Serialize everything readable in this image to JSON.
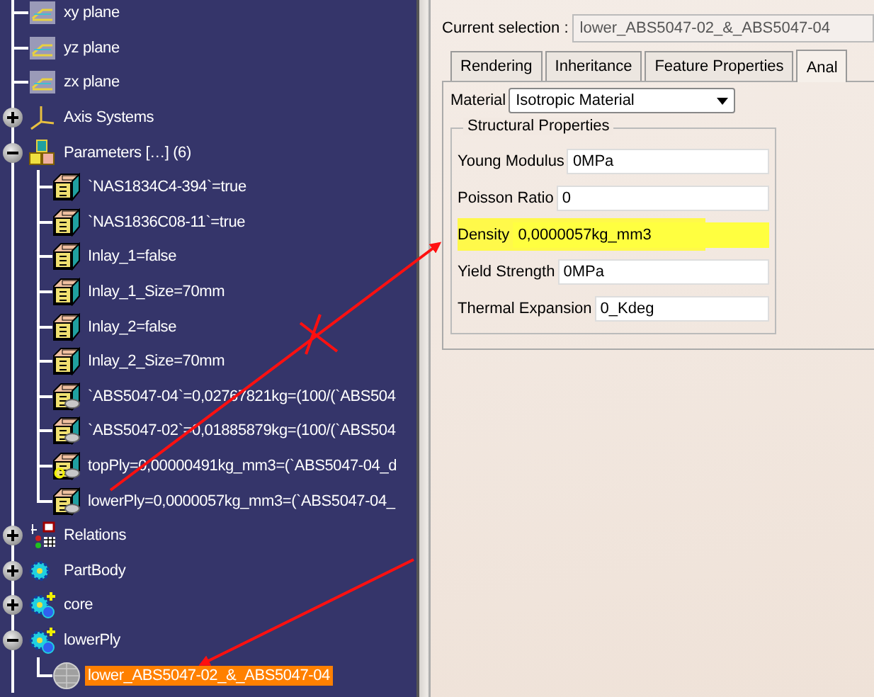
{
  "tree": [
    {
      "label": "xy plane",
      "kind": "plane",
      "selected": false
    },
    {
      "label": "yz plane",
      "kind": "plane",
      "selected": false
    },
    {
      "label": "zx plane",
      "kind": "plane",
      "selected": false
    },
    {
      "label": "Axis Systems",
      "kind": "axis",
      "selected": false,
      "expanded": false
    },
    {
      "label": "Parameters […] (6)",
      "kind": "parameters",
      "selected": false,
      "expanded": true,
      "children": [
        {
          "label": "`NAS1834C4-394`=true",
          "kind": "parameter",
          "selected": false
        },
        {
          "label": "`NAS1836C08-11`=true",
          "kind": "parameter",
          "selected": false
        },
        {
          "label": "Inlay_1=false",
          "kind": "parameter",
          "selected": false
        },
        {
          "label": "Inlay_1_Size=70mm",
          "kind": "parameter",
          "selected": false
        },
        {
          "label": "Inlay_2=false",
          "kind": "parameter",
          "selected": false
        },
        {
          "label": "Inlay_2_Size=70mm",
          "kind": "parameter",
          "selected": false
        },
        {
          "label": "`ABS5047-04`=0,02767821kg=(100/(`ABS504",
          "kind": "formula",
          "selected": false
        },
        {
          "label": "`ABS5047-02`=0,01885879kg=(100/(`ABS504",
          "kind": "formula",
          "selected": false
        },
        {
          "label": "topPly=0,00000491kg_mm3=(`ABS5047-04_d",
          "kind": "law",
          "selected": false
        },
        {
          "label": "lowerPly=0,0000057kg_mm3=(`ABS5047-04_",
          "kind": "formula",
          "selected": false
        }
      ]
    },
    {
      "label": "Relations",
      "kind": "relations",
      "selected": false,
      "expanded": false
    },
    {
      "label": "PartBody",
      "kind": "body",
      "selected": false,
      "expanded": false
    },
    {
      "label": "core",
      "kind": "geoset",
      "selected": false,
      "expanded": false
    },
    {
      "label": "lowerPly",
      "kind": "geoset",
      "selected": false,
      "expanded": true,
      "children": [
        {
          "label": "lower_ABS5047-02_&_ABS5047-04",
          "kind": "material",
          "selected": true
        }
      ]
    }
  ],
  "current_selection": {
    "label": "Current selection :",
    "value": "lower_ABS5047-02_&_ABS5047-04"
  },
  "tabs": [
    {
      "label": "Rendering",
      "selected": false
    },
    {
      "label": "Inheritance",
      "selected": false
    },
    {
      "label": "Feature Properties",
      "selected": false
    },
    {
      "label": "Anal",
      "selected": true
    }
  ],
  "material": {
    "label": "Material",
    "value": "Isotropic Material"
  },
  "structural_properties": {
    "title": "Structural Properties",
    "fields": [
      {
        "label": "Young Modulus",
        "value": "0MPa",
        "highlighted": false
      },
      {
        "label": "Poisson Ratio",
        "value": "0",
        "highlighted": false
      },
      {
        "label": "Density",
        "value": "0,0000057kg_mm3",
        "highlighted": true
      },
      {
        "label": "Yield Strength",
        "value": "0MPa",
        "highlighted": false
      },
      {
        "label": "Thermal Expansion",
        "value": "0_Kdeg",
        "highlighted": false
      }
    ]
  }
}
